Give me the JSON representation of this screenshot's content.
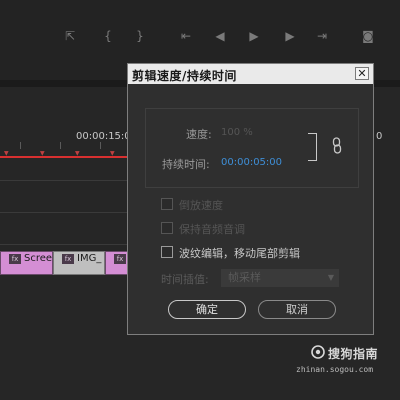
{
  "timeline": {
    "timecode_left": "00:00:15:0",
    "timecode_right": "0",
    "clips": [
      {
        "label": "Scree"
      },
      {
        "label": "IMG_"
      }
    ],
    "fx_badge": "fx"
  },
  "dialog": {
    "title": "剪辑速度/持续时间",
    "close_glyph": "✕",
    "speed_label": "速度:",
    "speed_value": "100 %",
    "duration_label": "持续时间:",
    "duration_value": "00:00:05:00",
    "reverse_speed_label": "倒放速度",
    "maintain_audio_pitch_label": "保持音频音调",
    "ripple_edit_label": "波纹编辑，移动尾部剪辑",
    "time_interpolation_label": "时间插值:",
    "time_interpolation_value": "帧采样",
    "ok_label": "确定",
    "cancel_label": "取消"
  },
  "watermark": {
    "text": "搜狗指南",
    "url": "zhinan.sogou.com"
  },
  "colors": {
    "accent_blue": "#3e8ed6",
    "playhead_red": "#d83030",
    "clip_pink": "#d48ed4"
  }
}
